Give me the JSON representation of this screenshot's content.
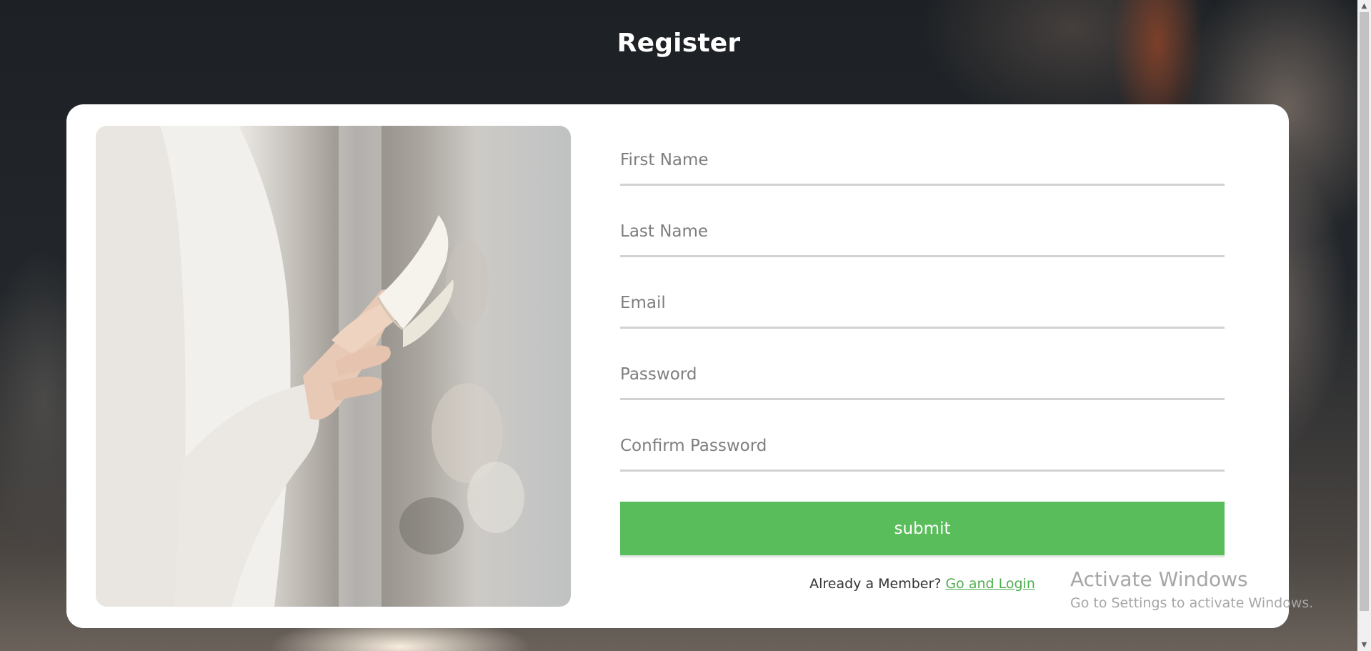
{
  "page": {
    "title": "Register"
  },
  "form": {
    "fields": [
      {
        "name": "first-name-input",
        "placeholder": "First Name",
        "value": ""
      },
      {
        "name": "last-name-input",
        "placeholder": "Last Name",
        "value": ""
      },
      {
        "name": "email-input",
        "placeholder": "Email",
        "value": ""
      },
      {
        "name": "password-input",
        "placeholder": "Password",
        "value": ""
      },
      {
        "name": "confirm-password-input",
        "placeholder": "Confirm Password",
        "value": ""
      }
    ],
    "submit_label": "submit",
    "member_prompt": "Already a Member?",
    "login_link": "Go and Login"
  },
  "watermark": {
    "title": "Activate Windows",
    "subtitle": "Go to Settings to activate Windows."
  },
  "scrollbar": {
    "up_icon": "▲",
    "down_icon": "▼"
  },
  "colors": {
    "accent": "#5abd5b",
    "link": "#4fae4f",
    "underline": "#d2d2d2"
  }
}
